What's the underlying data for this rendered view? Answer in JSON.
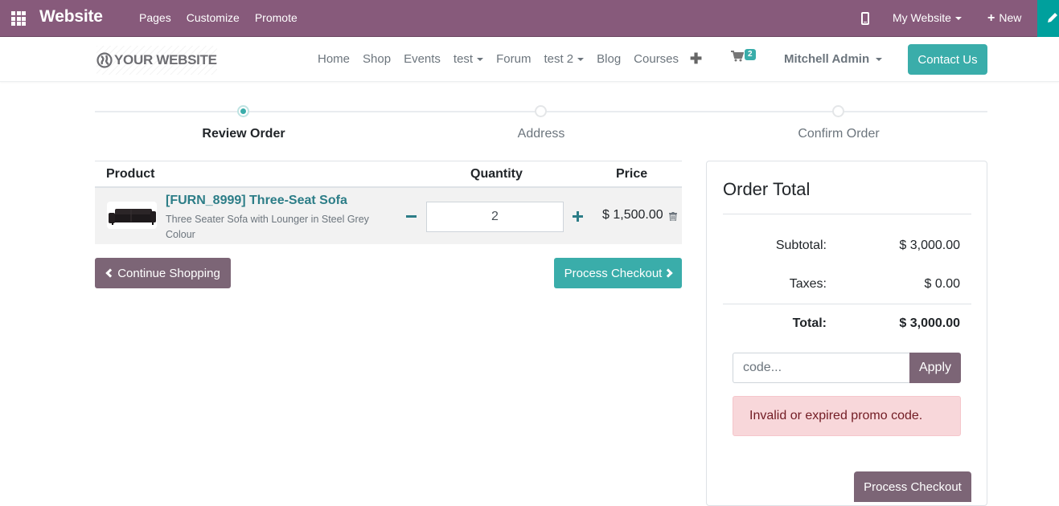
{
  "admin_bar": {
    "app_title": "Website",
    "menu": [
      "Pages",
      "Customize",
      "Promote"
    ],
    "website_selector": "My Website",
    "new_label": "New",
    "accent_color": "#875A7B",
    "edit_color": "#00A09D"
  },
  "site_header": {
    "logo_text": "YOUR WEBSITE",
    "nav": [
      {
        "label": "Home",
        "dropdown": false
      },
      {
        "label": "Shop",
        "dropdown": false
      },
      {
        "label": "Events",
        "dropdown": false
      },
      {
        "label": "test",
        "dropdown": true
      },
      {
        "label": "Forum",
        "dropdown": false
      },
      {
        "label": "test 2",
        "dropdown": true
      },
      {
        "label": "Blog",
        "dropdown": false
      },
      {
        "label": "Courses",
        "dropdown": false
      }
    ],
    "cart_count": "2",
    "user_name": "Mitchell Admin",
    "contact_label": "Contact Us"
  },
  "wizard": {
    "steps": [
      {
        "label": "Review Order",
        "active": true
      },
      {
        "label": "Address",
        "active": false
      },
      {
        "label": "Confirm Order",
        "active": false
      }
    ]
  },
  "cart": {
    "headers": {
      "product": "Product",
      "quantity": "Quantity",
      "price": "Price"
    },
    "lines": [
      {
        "name": "[FURN_8999] Three-Seat Sofa",
        "description": "Three Seater Sofa with Lounger in Steel Grey Colour",
        "quantity": "2",
        "price": "$ 1,500.00"
      }
    ],
    "continue_label": "Continue Shopping",
    "checkout_label": "Process Checkout"
  },
  "order_total": {
    "title": "Order Total",
    "subtotal_label": "Subtotal:",
    "subtotal_value": "$ 3,000.00",
    "taxes_label": "Taxes:",
    "taxes_value": "$ 0.00",
    "total_label": "Total:",
    "total_value": "$ 3,000.00",
    "promo_placeholder": "code...",
    "apply_label": "Apply",
    "promo_error": "Invalid or expired promo code.",
    "checkout_label": "Process Checkout"
  }
}
